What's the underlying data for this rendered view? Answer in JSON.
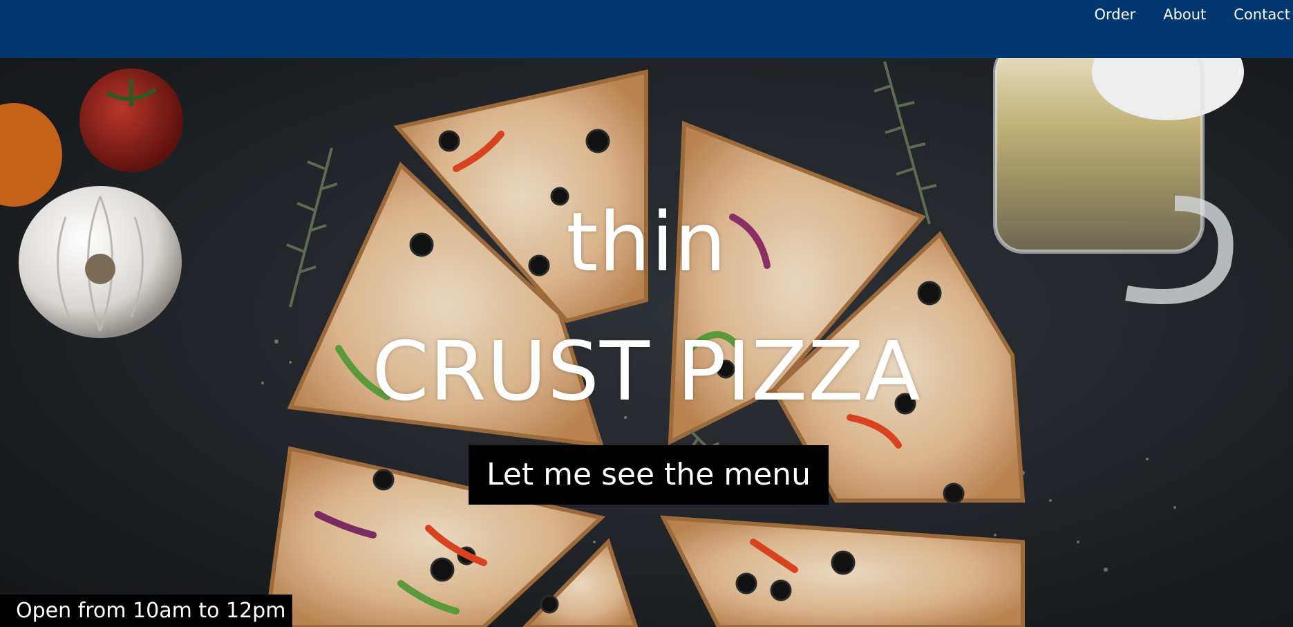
{
  "nav": {
    "items": [
      {
        "label": "Order"
      },
      {
        "label": "About"
      },
      {
        "label": "Contact"
      }
    ]
  },
  "hero": {
    "title_line1": "thin",
    "title_line2": "CRUST PIZZA",
    "cta_label": "Let me see the menu",
    "hours_text": "Open from 10am to 12pm",
    "background_image": "pizza-on-dark-table-photo"
  },
  "colors": {
    "navbar": "#033770",
    "nav_text": "#ffffff",
    "cta_bg": "#000000",
    "hero_text": "#ffffff"
  }
}
